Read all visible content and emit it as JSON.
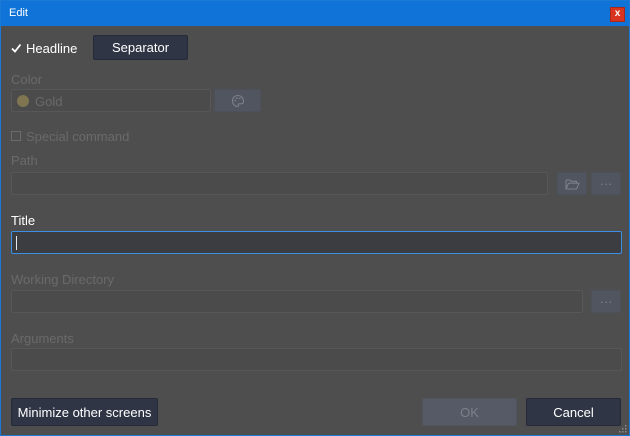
{
  "window": {
    "title": "Edit",
    "close_label": "x"
  },
  "headline": {
    "label": "Headline",
    "checked": true
  },
  "separator_button": "Separator",
  "color": {
    "label": "Color",
    "value": "Gold",
    "swatch": "#7f7550"
  },
  "special_command": {
    "label": "Special command",
    "checked": false
  },
  "path": {
    "label": "Path",
    "value": "",
    "ellipsis": "···"
  },
  "title_field": {
    "label": "Title",
    "value": ""
  },
  "working_directory": {
    "label": "Working Directory",
    "value": "",
    "ellipsis": "···"
  },
  "arguments": {
    "label": "Arguments",
    "value": ""
  },
  "footer": {
    "minimize_label": "Minimize other screens",
    "ok_label": "OK",
    "cancel_label": "Cancel"
  },
  "colors": {
    "titlebar": "#0f73d8",
    "accent_border": "#3d8fe6",
    "dark_button": "#2f3545"
  }
}
